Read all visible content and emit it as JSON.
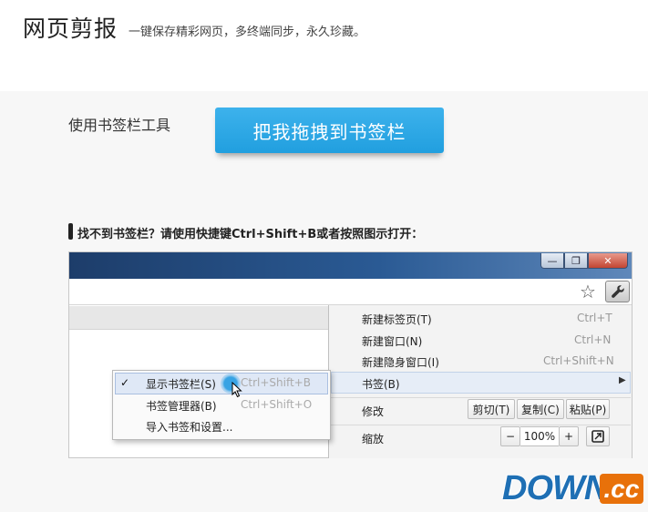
{
  "header": {
    "title": "网页剪报",
    "tagline": "一键保存精彩网页，多终端同步，永久珍藏。"
  },
  "toolbar": {
    "label": "使用书签栏工具",
    "bookmarklet_button": "把我拖拽到书签栏"
  },
  "hint": {
    "text": "找不到书签栏？请使用快捷键Ctrl+Shift+B或者按照图示打开："
  },
  "window_controls": {
    "minimize": "—",
    "restore": "❐",
    "close": "✕"
  },
  "menu": {
    "items": [
      {
        "label": "新建标签页(T)",
        "shortcut": "Ctrl+T"
      },
      {
        "label": "新建窗口(N)",
        "shortcut": "Ctrl+N"
      },
      {
        "label": "新建隐身窗口(I)",
        "shortcut": "Ctrl+Shift+N"
      },
      {
        "label": "书签(B)",
        "shortcut": ""
      }
    ],
    "edit_label": "修改",
    "cut": "剪切(T)",
    "copy": "复制(C)",
    "paste": "粘贴(P)",
    "zoom_label": "缩放",
    "zoom_minus": "−",
    "zoom_value": "100%",
    "zoom_plus": "+"
  },
  "submenu": {
    "items": [
      {
        "label": "显示书签栏(S)",
        "shortcut": "Ctrl+Shift+B",
        "checked": true
      },
      {
        "label": "书签管理器(B)",
        "shortcut": "Ctrl+Shift+O",
        "checked": false
      },
      {
        "label": "导入书签和设置...",
        "shortcut": "",
        "checked": false
      }
    ],
    "check_mark": "✓"
  },
  "watermark": {
    "text": "DOWN",
    "suffix": ".cc"
  },
  "colors": {
    "accent": "#2aa7e6",
    "titlebar": "#2a5a94",
    "watermark_blue": "#1e6fb4",
    "watermark_orange": "#e8710a"
  }
}
